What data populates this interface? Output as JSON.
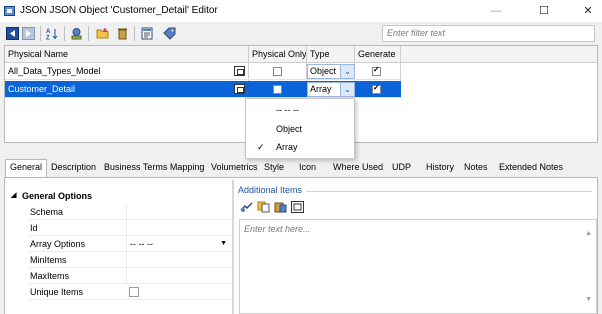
{
  "window": {
    "title": "JSON JSON Object 'Customer_Detail' Editor",
    "minimize_symbol": "—",
    "maximize_symbol": "☐",
    "close_symbol": "✕"
  },
  "toolbar": {
    "filter_placeholder": "Enter filter text",
    "icons": [
      "nav-back-icon",
      "nav-forward-icon",
      "sort-icon",
      "model-icon",
      "new-folder-icon",
      "delete-icon",
      "properties-icon",
      "tag-icon"
    ]
  },
  "grid": {
    "columns": [
      "Physical Name",
      "Physical Only",
      "Type",
      "Generate"
    ],
    "rows": [
      {
        "name": "All_Data_Types_Model",
        "physical_only": false,
        "type": "Object",
        "generate": true,
        "selected": false
      },
      {
        "name": "Customer_Detail",
        "physical_only": false,
        "type": "Array",
        "generate": true,
        "selected": true
      }
    ]
  },
  "type_dropdown": {
    "options": [
      "-- -- --",
      "Object",
      "Array"
    ],
    "selected": "Array",
    "check_symbol": "✓"
  },
  "tabs": [
    "General",
    "Description",
    "Business Terms Mapping",
    "Volumetrics",
    "Style",
    "Icon",
    "Where Used",
    "UDP",
    "History",
    "Notes",
    "Extended Notes"
  ],
  "active_tab": "General",
  "general_options": {
    "group_label": "General Options",
    "properties": [
      {
        "name": "Schema",
        "value": ""
      },
      {
        "name": "Id",
        "value": ""
      },
      {
        "name": "Array Options",
        "value": "-- -- --"
      },
      {
        "name": "MinItems",
        "value": ""
      },
      {
        "name": "MaxItems",
        "value": ""
      },
      {
        "name": "Unique Items",
        "value": ""
      }
    ]
  },
  "additional_items": {
    "label": "Additional Items",
    "placeholder": "Enter text here...",
    "icons": [
      "add-item-icon",
      "copy-item-icon",
      "paste-item-icon",
      "editor-icon"
    ]
  },
  "colors": {
    "selection": "#0a64d7",
    "group_label": "#1f54a8"
  }
}
